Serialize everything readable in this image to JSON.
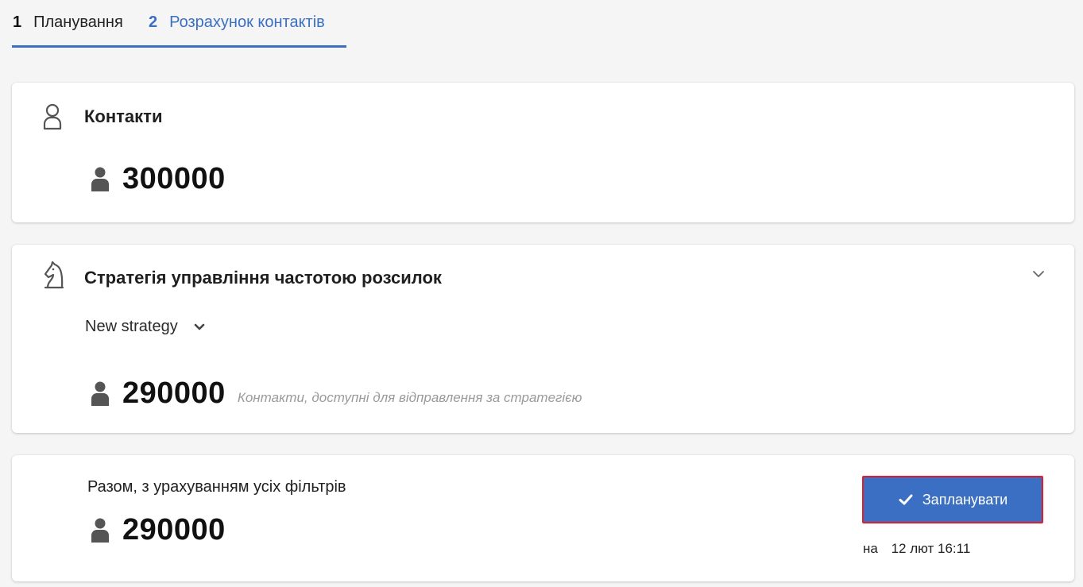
{
  "tabs": [
    {
      "num": "1",
      "label": "Планування"
    },
    {
      "num": "2",
      "label": "Розрахунок контактів"
    }
  ],
  "contacts": {
    "title": "Контакти",
    "count": "300000",
    "icon": "contact-outline-icon"
  },
  "strategy": {
    "title": "Стратегія управління частотою розсилок",
    "selected": "New strategy",
    "count": "290000",
    "note": "Контакти, доступні для відправлення за стратегією",
    "icon": "chess-knight-icon"
  },
  "total": {
    "label": "Разом, з урахуванням усіх фільтрів",
    "count": "290000"
  },
  "schedule": {
    "button_label": "Запланувати",
    "date_prefix": "на",
    "date": "12 лют 16:11"
  },
  "colors": {
    "accent": "#3a6fc4",
    "highlight_border": "#e01e2e",
    "person_icon": "#555555"
  }
}
